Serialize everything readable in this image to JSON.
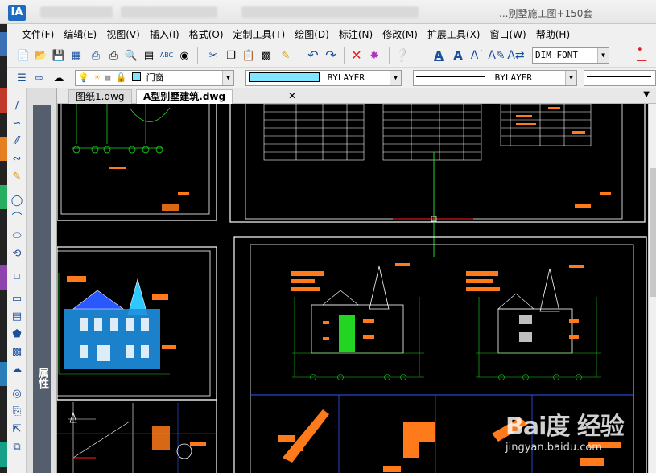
{
  "window": {
    "title": "...别墅施工图+150套"
  },
  "app_icon": "IA",
  "menubar": [
    {
      "label": "文件(F)"
    },
    {
      "label": "编辑(E)"
    },
    {
      "label": "视图(V)"
    },
    {
      "label": "插入(I)"
    },
    {
      "label": "格式(O)"
    },
    {
      "label": "定制工具(T)"
    },
    {
      "label": "绘图(D)"
    },
    {
      "label": "标注(N)"
    },
    {
      "label": "修改(M)"
    },
    {
      "label": "扩展工具(X)"
    },
    {
      "label": "窗口(W)"
    },
    {
      "label": "帮助(H)"
    }
  ],
  "toolbar1": {
    "text_style": "DIM_FONT",
    "icons": [
      "new-icon",
      "open-icon",
      "save-icon",
      "saveas-icon",
      "print-icon",
      "plot-icon",
      "preview-icon",
      "find-icon",
      "spellcheck-icon",
      "binoculars-icon",
      "cut-icon",
      "copy-icon",
      "paste-icon",
      "paste-special-icon",
      "matchprop-icon",
      "undo-icon",
      "redo-icon",
      "erase-icon",
      "snap-icon",
      "help-icon",
      "text-a-icon",
      "text-b-icon",
      "text-c-icon",
      "text-d-icon",
      "text-e-icon"
    ]
  },
  "toolbar2": {
    "layer_name": "门窗",
    "color": "BYLAYER",
    "color_swatch": "#7fe6ff",
    "linetype": "BYLAYER"
  },
  "tabs": [
    {
      "label": "图纸1.dwg",
      "active": false
    },
    {
      "label": "A型别墅建筑.dwg",
      "active": true
    }
  ],
  "left_tools": [
    "line-icon",
    "polyline-icon",
    "construction-line-icon",
    "spline-icon",
    "pencil-icon",
    "circle-icon",
    "arc-icon",
    "ellipse-icon",
    "revcloud-icon",
    "point-icon",
    "rectangle-icon",
    "hatch-icon",
    "polygon-icon",
    "region-icon",
    "cloud-icon",
    "donut-icon",
    "insert-block-icon",
    "table-icon",
    "wipeout-icon"
  ],
  "properties_label": "属性",
  "watermark": {
    "logo": "Bai度 经验",
    "url": "jingyan.baidu.com"
  },
  "colors": {
    "canvas_bg": "#000000",
    "frame": "#ffffff",
    "drawing_green": "#23d423",
    "drawing_orange": "#ff7a1a",
    "drawing_cyan": "#2ec8ff",
    "drawing_red": "#ff2020",
    "drawing_blue": "#2a58ff"
  }
}
